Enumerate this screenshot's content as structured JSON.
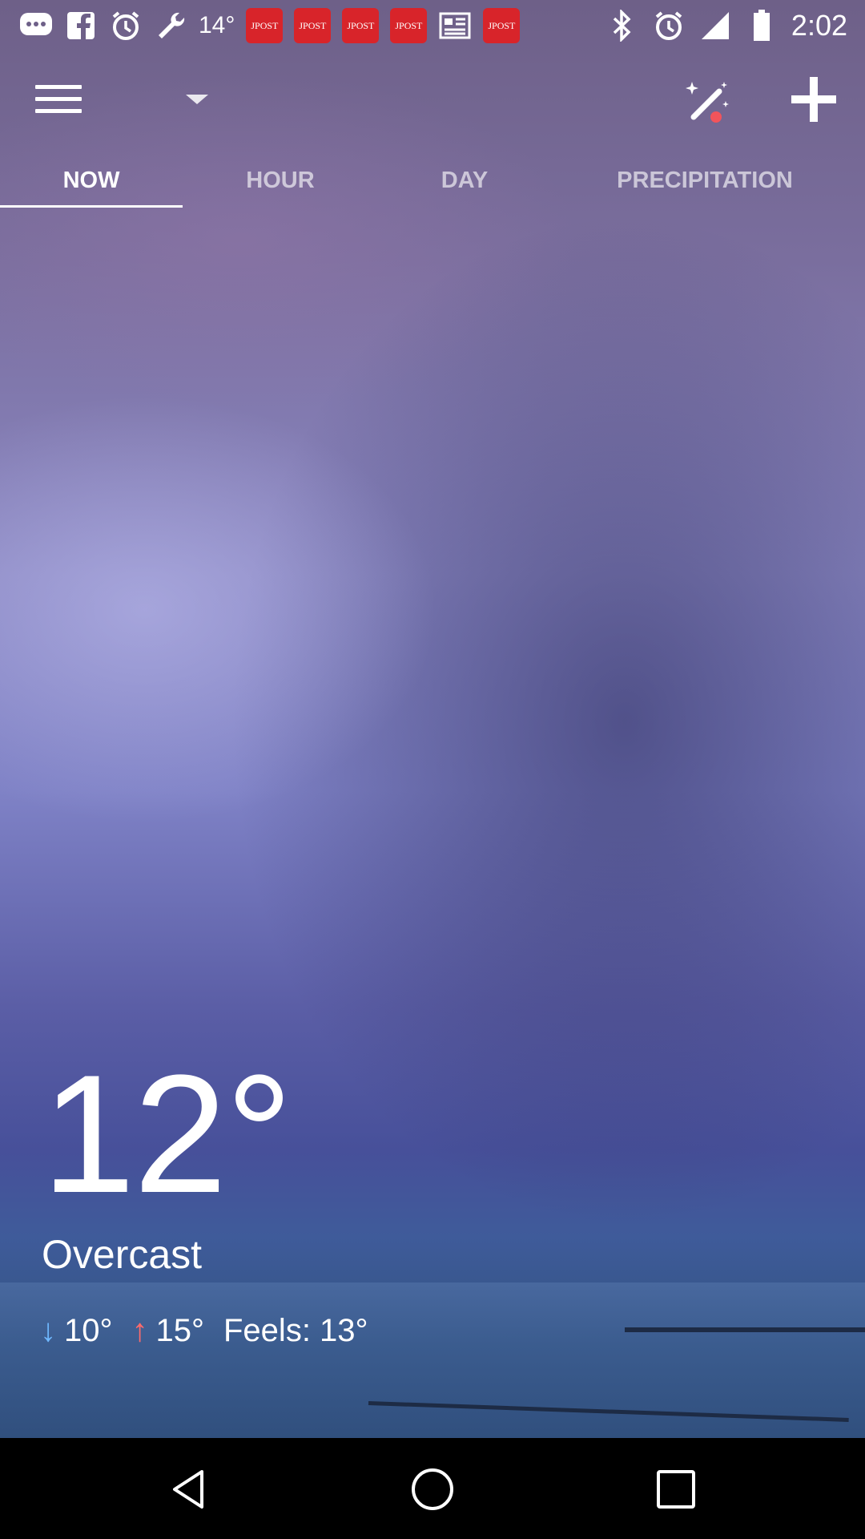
{
  "status_bar": {
    "temperature": "14°",
    "post_label": "JPOST",
    "time": "2:02",
    "icons": [
      "messenger-icon",
      "facebook-icon",
      "alarm-icon",
      "wrench-icon",
      "jpost-icon",
      "jpost-icon",
      "jpost-icon",
      "jpost-icon",
      "news-icon",
      "jpost-icon",
      "bluetooth-icon",
      "alarm-icon",
      "signal-icon",
      "battery-icon"
    ]
  },
  "toolbar": {
    "menu_icon": "menu-icon",
    "dropdown_icon": "chevron-down-icon",
    "magic_icon": "magic-wand-icon",
    "add_icon": "plus-icon"
  },
  "tabs": [
    {
      "label": "NOW",
      "active": true
    },
    {
      "label": "HOUR",
      "active": false
    },
    {
      "label": "DAY",
      "active": false
    },
    {
      "label": "PRECIPITATION",
      "active": false
    }
  ],
  "weather": {
    "temperature": "12°",
    "condition": "Overcast",
    "low": "10°",
    "high": "15°",
    "feels_like": "Feels: 13°"
  },
  "colors": {
    "low_arrow": "#6fb8ff",
    "high_arrow": "#ff6b6b",
    "post_badge": "#d8242a"
  },
  "nav_bar": {
    "back_icon": "back-triangle-icon",
    "home_icon": "home-circle-icon",
    "recents_icon": "recents-square-icon"
  }
}
